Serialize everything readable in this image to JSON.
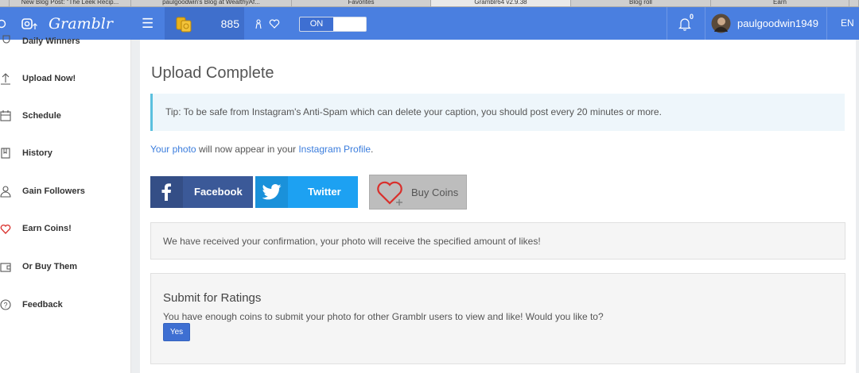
{
  "browser_tabs": [
    "New Blog Post: \"The Leek Recip...",
    "paulgoodwin's Blog at WealthyAf...",
    "Favorites",
    "Gramblr64 v2.9.38",
    "Blog roll",
    "Earn"
  ],
  "topbar": {
    "logo": "Gramblr",
    "coins": "885",
    "toggle_label": "ON",
    "notification_count": "0",
    "username": "paulgoodwin1949",
    "language": "EN"
  },
  "sidebar": {
    "items": [
      {
        "label": "Daily Winners",
        "icon": "trophy-icon"
      },
      {
        "label": "Upload Now!",
        "icon": "upload-icon"
      },
      {
        "label": "Schedule",
        "icon": "calendar-icon"
      },
      {
        "label": "History",
        "icon": "book-icon"
      },
      {
        "label": "Gain Followers",
        "icon": "user-icon"
      },
      {
        "label": "Earn Coins!",
        "icon": "heart-icon"
      },
      {
        "label": "Or Buy Them",
        "icon": "wallet-icon"
      },
      {
        "label": "Feedback",
        "icon": "question-icon"
      }
    ]
  },
  "main": {
    "title": "Upload Complete",
    "tip": "Tip: To be safe from Instagram's Anti-Spam which can delete your caption, you should post every 20 minutes or more.",
    "photo_link": "Your photo",
    "photo_mid": " will now appear in your ",
    "profile_link": "Instagram Profile",
    "photo_end": ".",
    "facebook_label": "Facebook",
    "twitter_label": "Twitter",
    "buy_coins_label": "Buy Coins",
    "confirmation": "We have received your confirmation, your photo will receive the specified amount of likes!",
    "rating_title": "Submit for Ratings",
    "rating_text": "You have enough coins to submit your photo for other Gramblr users to view and like! Would you like to?",
    "yes_label": "Yes"
  },
  "colors": {
    "topbar": "#4a7fe0",
    "facebook": "#3b5998",
    "twitter": "#1da1f2",
    "link": "#3b7ddd",
    "tip_border": "#5bc0de"
  }
}
